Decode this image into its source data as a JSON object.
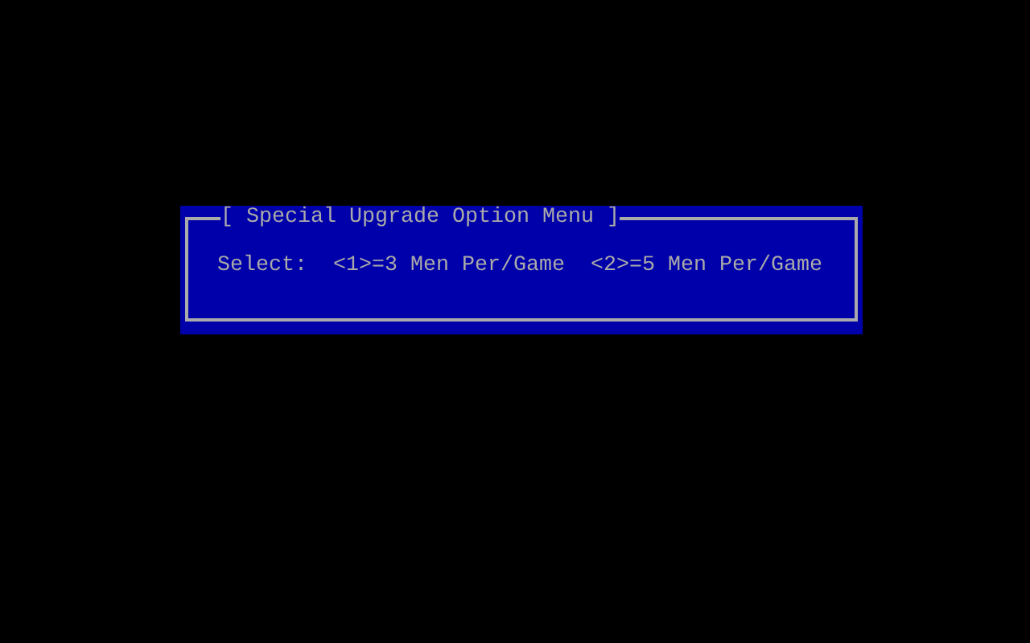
{
  "menu": {
    "title": "[ Special Upgrade Option Menu ]",
    "prompt": "Select:",
    "options": [
      "<1>=3 Men Per/Game",
      "<2>=5 Men Per/Game"
    ]
  }
}
